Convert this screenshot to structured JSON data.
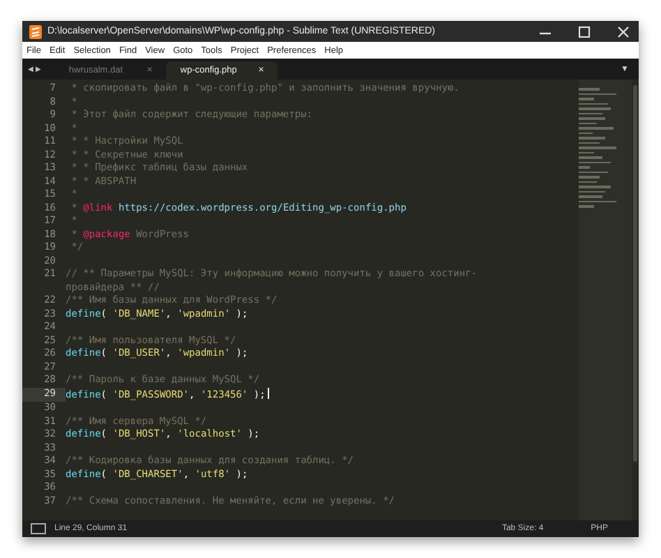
{
  "window": {
    "title": "D:\\localserver\\OpenServer\\domains\\WP\\wp-config.php - Sublime Text (UNREGISTERED)"
  },
  "menu": [
    "File",
    "Edit",
    "Selection",
    "Find",
    "View",
    "Goto",
    "Tools",
    "Project",
    "Preferences",
    "Help"
  ],
  "tab_bar": {
    "nav": "◀ ▶",
    "dropdown": "▼",
    "tabs": [
      {
        "label": "hwrusalm.dat",
        "close": "×",
        "selected": false
      },
      {
        "label": "wp-config.php",
        "close": "×",
        "selected": true
      }
    ]
  },
  "editor": {
    "lines": [
      {
        "number": "7",
        "current": false,
        "tokens": [
          {
            "kind": "comment",
            "text": " * скопировать файл в \"wp-config.php\" и заполнить значения вручную."
          }
        ]
      },
      {
        "number": "8",
        "current": false,
        "tokens": [
          {
            "kind": "comment",
            "text": " *"
          }
        ]
      },
      {
        "number": "9",
        "current": false,
        "tokens": [
          {
            "kind": "comment",
            "text": " * Этот файл содержит следующие параметры:"
          }
        ]
      },
      {
        "number": "10",
        "current": false,
        "tokens": [
          {
            "kind": "comment",
            "text": " *"
          }
        ]
      },
      {
        "number": "11",
        "current": false,
        "tokens": [
          {
            "kind": "comment",
            "text": " * * Настройки MySQL"
          }
        ]
      },
      {
        "number": "12",
        "current": false,
        "tokens": [
          {
            "kind": "comment",
            "text": " * * Секретные ключи"
          }
        ]
      },
      {
        "number": "13",
        "current": false,
        "tokens": [
          {
            "kind": "comment",
            "text": " * * Префикс таблиц базы данных"
          }
        ]
      },
      {
        "number": "14",
        "current": false,
        "tokens": [
          {
            "kind": "comment",
            "text": " * * ABSPATH"
          }
        ]
      },
      {
        "number": "15",
        "current": false,
        "tokens": [
          {
            "kind": "comment",
            "text": " *"
          }
        ]
      },
      {
        "number": "16",
        "current": false,
        "tokens": [
          {
            "kind": "comment",
            "text": " * "
          },
          {
            "kind": "tag",
            "text": "@link"
          },
          {
            "kind": "url",
            "text": " https://codex.wordpress.org/Editing_wp-config.php"
          }
        ]
      },
      {
        "number": "17",
        "current": false,
        "tokens": [
          {
            "kind": "comment",
            "text": " *"
          }
        ]
      },
      {
        "number": "18",
        "current": false,
        "tokens": [
          {
            "kind": "comment",
            "text": " * "
          },
          {
            "kind": "tag",
            "text": "@package"
          },
          {
            "kind": "comment",
            "text": " WordPress"
          }
        ]
      },
      {
        "number": "19",
        "current": false,
        "tokens": [
          {
            "kind": "comment",
            "text": " */"
          }
        ]
      },
      {
        "number": "20",
        "current": false
      },
      {
        "number": "21",
        "current": false,
        "tokens": [
          {
            "kind": "comment",
            "text": "// ** Параметры MySQL: Эту информацию можно получить у вашего хостинг-провайдера ** //"
          }
        ]
      },
      {
        "number": "22",
        "current": false,
        "tokens": [
          {
            "kind": "comment",
            "text": "/** Имя базы данных для WordPress */"
          }
        ]
      },
      {
        "number": "23",
        "current": false,
        "tokens": [
          {
            "kind": "func",
            "text": "define"
          },
          {
            "kind": "plain",
            "text": "( "
          },
          {
            "kind": "string",
            "text": "'DB_NAME'"
          },
          {
            "kind": "plain",
            "text": ", "
          },
          {
            "kind": "string",
            "text": "'wpadmin'"
          },
          {
            "kind": "plain",
            "text": " );"
          }
        ]
      },
      {
        "number": "24",
        "current": false
      },
      {
        "number": "25",
        "current": false,
        "tokens": [
          {
            "kind": "comment",
            "text": "/** Имя пользователя MySQL */"
          }
        ]
      },
      {
        "number": "26",
        "current": false,
        "tokens": [
          {
            "kind": "func",
            "text": "define"
          },
          {
            "kind": "plain",
            "text": "( "
          },
          {
            "kind": "string",
            "text": "'DB_USER'"
          },
          {
            "kind": "plain",
            "text": ", "
          },
          {
            "kind": "string",
            "text": "'wpadmin'"
          },
          {
            "kind": "plain",
            "text": " );"
          }
        ]
      },
      {
        "number": "27",
        "current": false
      },
      {
        "number": "28",
        "current": false,
        "tokens": [
          {
            "kind": "comment",
            "text": "/** Пароль к базе данных MySQL */"
          }
        ]
      },
      {
        "number": "29",
        "current": true,
        "tokens": [
          {
            "kind": "func",
            "text": "define"
          },
          {
            "kind": "plain",
            "text": "( "
          },
          {
            "kind": "string",
            "text": "'DB_PASSWORD'"
          },
          {
            "kind": "plain",
            "text": ", "
          },
          {
            "kind": "string",
            "text": "'123456'"
          },
          {
            "kind": "plain",
            "text": " );"
          }
        ]
      },
      {
        "number": "30",
        "current": false
      },
      {
        "number": "31",
        "current": false,
        "tokens": [
          {
            "kind": "comment",
            "text": "/** Имя сервера MySQL */"
          }
        ]
      },
      {
        "number": "32",
        "current": false,
        "tokens": [
          {
            "kind": "func",
            "text": "define"
          },
          {
            "kind": "plain",
            "text": "( "
          },
          {
            "kind": "string",
            "text": "'DB_HOST'"
          },
          {
            "kind": "plain",
            "text": ", "
          },
          {
            "kind": "string",
            "text": "'localhost'"
          },
          {
            "kind": "plain",
            "text": " );"
          }
        ]
      },
      {
        "number": "33",
        "current": false
      },
      {
        "number": "34",
        "current": false,
        "tokens": [
          {
            "kind": "comment",
            "text": "/** Кодировка базы данных для создания таблиц. */"
          }
        ]
      },
      {
        "number": "35",
        "current": false,
        "tokens": [
          {
            "kind": "func",
            "text": "define"
          },
          {
            "kind": "plain",
            "text": "( "
          },
          {
            "kind": "string",
            "text": "'DB_CHARSET'"
          },
          {
            "kind": "plain",
            "text": ", "
          },
          {
            "kind": "string",
            "text": "'utf8'"
          },
          {
            "kind": "plain",
            "text": " );"
          }
        ]
      },
      {
        "number": "36",
        "current": false
      },
      {
        "number": "37",
        "current": false,
        "tokens": [
          {
            "kind": "comment",
            "text": "/** Схема сопоставления. Не меняйте, если не уверены. */"
          }
        ]
      }
    ]
  },
  "status_bar": {
    "position": "Line 29, Column 31",
    "tab_size": "Tab Size: 4",
    "syntax": "PHP"
  }
}
